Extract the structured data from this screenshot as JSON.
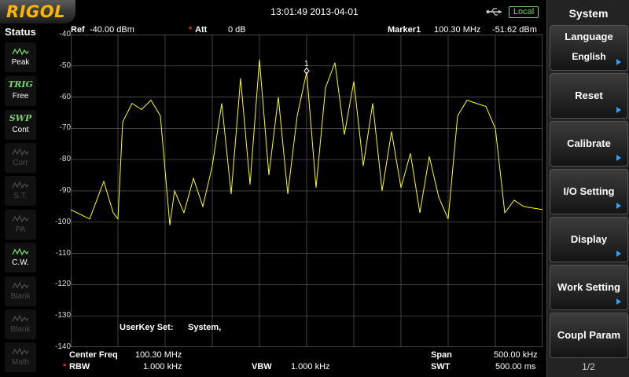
{
  "topbar": {
    "logo": "RIGOL",
    "datetime": "13:01:49 2013-04-01",
    "remote_status": "Local"
  },
  "status_panel": {
    "title": "Status",
    "items": [
      {
        "label": "Peak",
        "glyph": "",
        "icon": "peak-detector-icon",
        "active": true
      },
      {
        "label": "Free",
        "glyph": "TRIG",
        "icon": "trigger-icon",
        "active": true
      },
      {
        "label": "Cont",
        "glyph": "SWP",
        "icon": "sweep-icon",
        "active": true
      },
      {
        "label": "Corr",
        "glyph": "",
        "icon": "correction-icon",
        "active": false
      },
      {
        "label": "S.T.",
        "glyph": "",
        "icon": "signal-track-icon",
        "active": false
      },
      {
        "label": "PA",
        "glyph": "",
        "icon": "preamp-icon",
        "active": false
      },
      {
        "label": "C.W.",
        "glyph": "",
        "icon": "clear-write-icon",
        "active": true
      },
      {
        "label": "Blank",
        "glyph": "",
        "icon": "blank-trace-icon",
        "active": false
      },
      {
        "label": "Blank",
        "glyph": "",
        "icon": "blank-trace-icon",
        "active": false
      },
      {
        "label": "Math",
        "glyph": "",
        "icon": "math-trace-icon",
        "active": false
      }
    ]
  },
  "header": {
    "ref_label": "Ref",
    "ref_value": "-40.00 dBm",
    "att_marker": "*",
    "att_label": "Att",
    "att_value": "0 dB",
    "marker_label": "Marker1",
    "marker_freq": "100.30 MHz",
    "marker_level": "-51.62 dBm"
  },
  "y_axis_labels": [
    "-40",
    "-50",
    "-60",
    "-70",
    "-80",
    "-90",
    "-100",
    "-110",
    "-120",
    "-130",
    "-140"
  ],
  "plot": {
    "userkey_label": "UserKey Set:",
    "userkey_value": "System,",
    "marker_number": "1",
    "trace_color": "#ffff00",
    "grid_color": "#5a5a5a"
  },
  "footer": {
    "center_freq_label": "Center Freq",
    "center_freq_value": "100.30 MHz",
    "span_label": "Span",
    "span_value": "500.00 kHz",
    "rbw_marker": "*",
    "rbw_label": "RBW",
    "rbw_value": "1.000 kHz",
    "vbw_label": "VBW",
    "vbw_value": "1.000 kHz",
    "swt_label": "SWT",
    "swt_value": "500.00 ms"
  },
  "menu": {
    "title": "System",
    "keys": [
      {
        "label": "Language",
        "sub": "English",
        "has_submenu": true
      },
      {
        "label": "Reset",
        "sub": "",
        "has_submenu": true
      },
      {
        "label": "Calibrate",
        "sub": "",
        "has_submenu": true
      },
      {
        "label": "I/O Setting",
        "sub": "",
        "has_submenu": true
      },
      {
        "label": "Display",
        "sub": "",
        "has_submenu": true
      },
      {
        "label": "Work Setting",
        "sub": "",
        "has_submenu": true
      },
      {
        "label": "Coupl Param",
        "sub": "",
        "has_submenu": false
      }
    ],
    "page": "1/2"
  },
  "chart_data": {
    "type": "line",
    "title": "",
    "xlabel": "",
    "ylabel": "",
    "x_unit": "MHz",
    "y_unit": "dBm",
    "xlim": [
      100.05,
      100.55
    ],
    "ylim": [
      -140,
      -40
    ],
    "grid": true,
    "series": [
      {
        "x": [
          100.05,
          100.07,
          100.085,
          100.095,
          100.1,
          100.105,
          100.115,
          100.125,
          100.135,
          100.145,
          100.155,
          100.16,
          100.17,
          100.18,
          100.19,
          100.2,
          100.21,
          100.22,
          100.23,
          100.24,
          100.25,
          100.26,
          100.27,
          100.28,
          100.29,
          100.3,
          100.31,
          100.32,
          100.33,
          100.34,
          100.35,
          100.36,
          100.37,
          100.38,
          100.39,
          100.4,
          100.41,
          100.42,
          100.43,
          100.44,
          100.45,
          100.46,
          100.47,
          100.48,
          100.49,
          100.5,
          100.51,
          100.52,
          100.53,
          100.55
        ],
        "y": [
          -96,
          -99,
          -87,
          -97,
          -99,
          -68,
          -62,
          -64,
          -61,
          -66,
          -101,
          -90,
          -97,
          -86,
          -95,
          -82,
          -62,
          -91,
          -54,
          -88,
          -48,
          -85,
          -60,
          -91,
          -66,
          -52,
          -89,
          -57,
          -49,
          -72,
          -55,
          -82,
          -62,
          -90,
          -71,
          -89,
          -78,
          -97,
          -79,
          -92,
          -99,
          -66,
          -61,
          -62,
          -63,
          -70,
          -97,
          -93,
          -95,
          -96
        ]
      }
    ],
    "markers": [
      {
        "name": "1",
        "x": 100.3,
        "y": -51.62
      }
    ]
  }
}
